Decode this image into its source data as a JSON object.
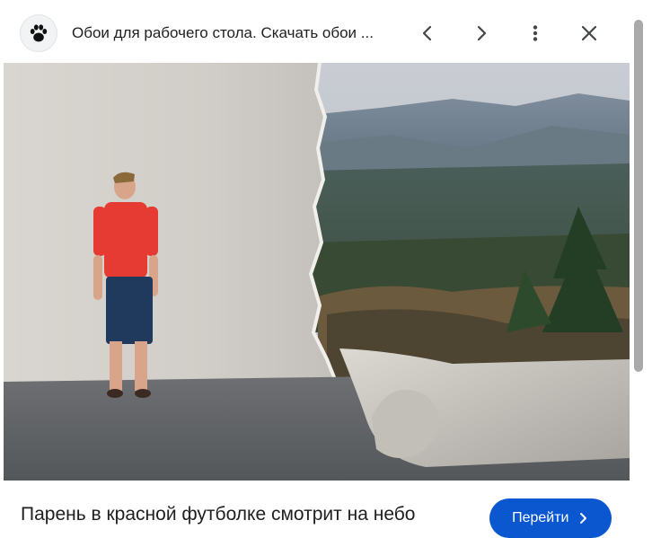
{
  "header": {
    "site_title": "Обои для рабочего стола. Скачать обои ...",
    "favicon_icon": "paw-icon",
    "prev_icon": "chevron-left-icon",
    "next_icon": "chevron-right-icon",
    "more_icon": "more-vert-icon",
    "close_icon": "close-icon"
  },
  "image": {
    "icon": "photo-man-red-shirt-torn-wall-landscape"
  },
  "caption": {
    "title": "Парень в красной футболке смотрит на небо",
    "button_label": "Перейти",
    "button_icon": "chevron-right-icon",
    "accent_color": "#0b57d0"
  }
}
